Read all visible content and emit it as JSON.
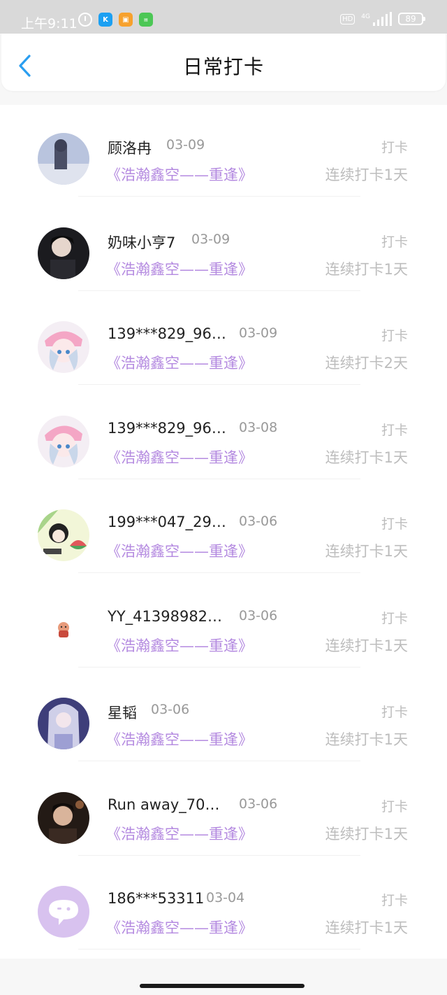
{
  "status_bar": {
    "time": "上午9:11",
    "battery": "89",
    "network": "4G",
    "hd": "HD",
    "icons": [
      "alarm-icon",
      "app-k-icon",
      "app-orange-icon",
      "app-green-icon"
    ]
  },
  "header": {
    "title": "日常打卡",
    "back_icon": "chevron-left-icon"
  },
  "colors": {
    "accent": "#2a9ef0",
    "book_title": "#b48ae0",
    "muted": "#bdbdbd"
  },
  "checkins": [
    {
      "name": "顾洛冉",
      "date": "03-09",
      "action": "打卡",
      "book": "《浩瀚鑫空——重逢》",
      "streak": "连续打卡1天"
    },
    {
      "name": "奶味小亨7",
      "date": "03-09",
      "action": "打卡",
      "book": "《浩瀚鑫空——重逢》",
      "streak": "连续打卡1天"
    },
    {
      "name": "139***829_96…",
      "date": "03-09",
      "action": "打卡",
      "book": "《浩瀚鑫空——重逢》",
      "streak": "连续打卡2天"
    },
    {
      "name": "139***829_96…",
      "date": "03-08",
      "action": "打卡",
      "book": "《浩瀚鑫空——重逢》",
      "streak": "连续打卡1天"
    },
    {
      "name": "199***047_29…",
      "date": "03-06",
      "action": "打卡",
      "book": "《浩瀚鑫空——重逢》",
      "streak": "连续打卡1天"
    },
    {
      "name": "YY_41398982…",
      "date": "03-06",
      "action": "打卡",
      "book": "《浩瀚鑫空——重逢》",
      "streak": "连续打卡1天"
    },
    {
      "name": "星韬",
      "date": "03-06",
      "action": "打卡",
      "book": "《浩瀚鑫空——重逢》",
      "streak": "连续打卡1天"
    },
    {
      "name": "Run away_70…",
      "date": "03-06",
      "action": "打卡",
      "book": "《浩瀚鑫空——重逢》",
      "streak": "连续打卡1天"
    },
    {
      "name": "186***53311",
      "date": "03-04",
      "action": "打卡",
      "book": "《浩瀚鑫空——重逢》",
      "streak": "连续打卡1天"
    }
  ]
}
